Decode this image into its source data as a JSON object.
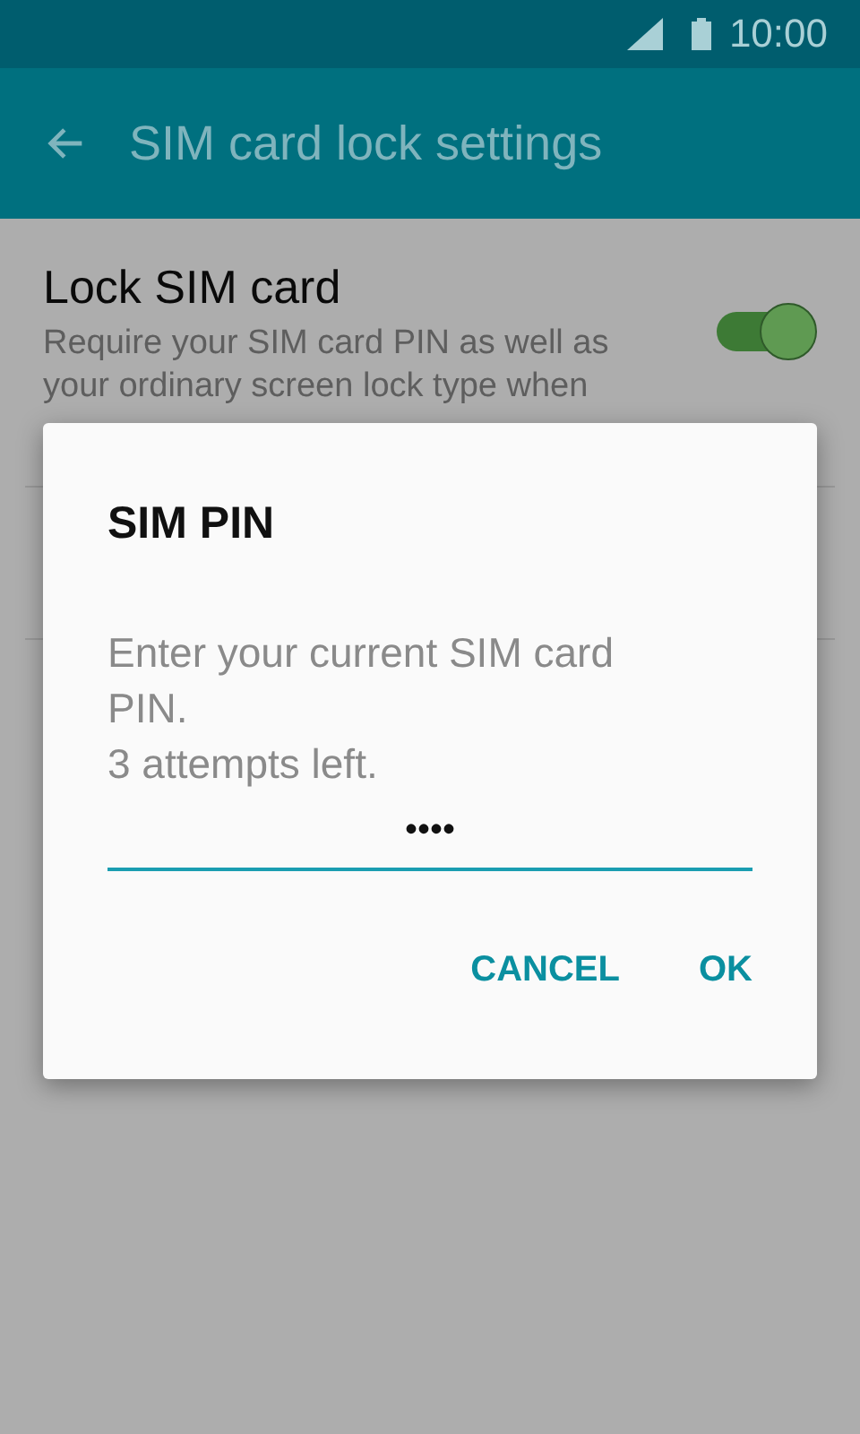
{
  "status_bar": {
    "time": "10:00"
  },
  "app_bar": {
    "title": "SIM card lock settings"
  },
  "settings": [
    {
      "kind": "switch",
      "title": "Lock SIM card",
      "summary": "Require your SIM card PIN as well as your ordinary screen lock type when",
      "on": true
    }
  ],
  "dialog": {
    "title": "SIM PIN",
    "message": "Enter your current SIM card PIN.",
    "attempts": "3 attempts left.",
    "field": {
      "value": "••••"
    },
    "buttons": [
      "CANCEL",
      "OK"
    ]
  }
}
